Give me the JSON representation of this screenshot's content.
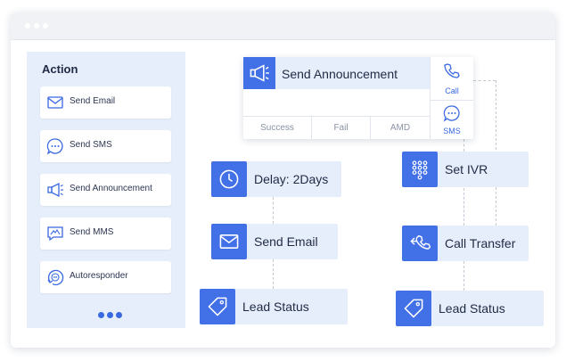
{
  "sidebar": {
    "title": "Action",
    "items": [
      {
        "label": "Send Email",
        "icon": "email-icon"
      },
      {
        "label": "Send SMS",
        "icon": "sms-chat-icon"
      },
      {
        "label": "Send Announcement",
        "icon": "megaphone-icon"
      },
      {
        "label": "Send MMS",
        "icon": "mms-image-icon"
      },
      {
        "label": "Autoresponder",
        "icon": "autoresponder-icon"
      }
    ],
    "more_icon": "more-dots-icon"
  },
  "flow": {
    "announcement": {
      "label": "Send Announcement",
      "outcomes": [
        "Success",
        "Fail",
        "AMD"
      ],
      "call_label": "Call",
      "sms_label": "SMS"
    },
    "delay": {
      "label": "Delay: 2Days"
    },
    "left_email": {
      "label": "Send Email"
    },
    "left_lead": {
      "label": "Lead Status"
    },
    "ivr": {
      "label": "Set IVR"
    },
    "transfer": {
      "label": "Call Transfer"
    },
    "right_lead": {
      "label": "Lead Status"
    }
  },
  "colors": {
    "accent": "#4270e6",
    "node_bg": "#e6eefb",
    "text": "#1f2a44"
  }
}
